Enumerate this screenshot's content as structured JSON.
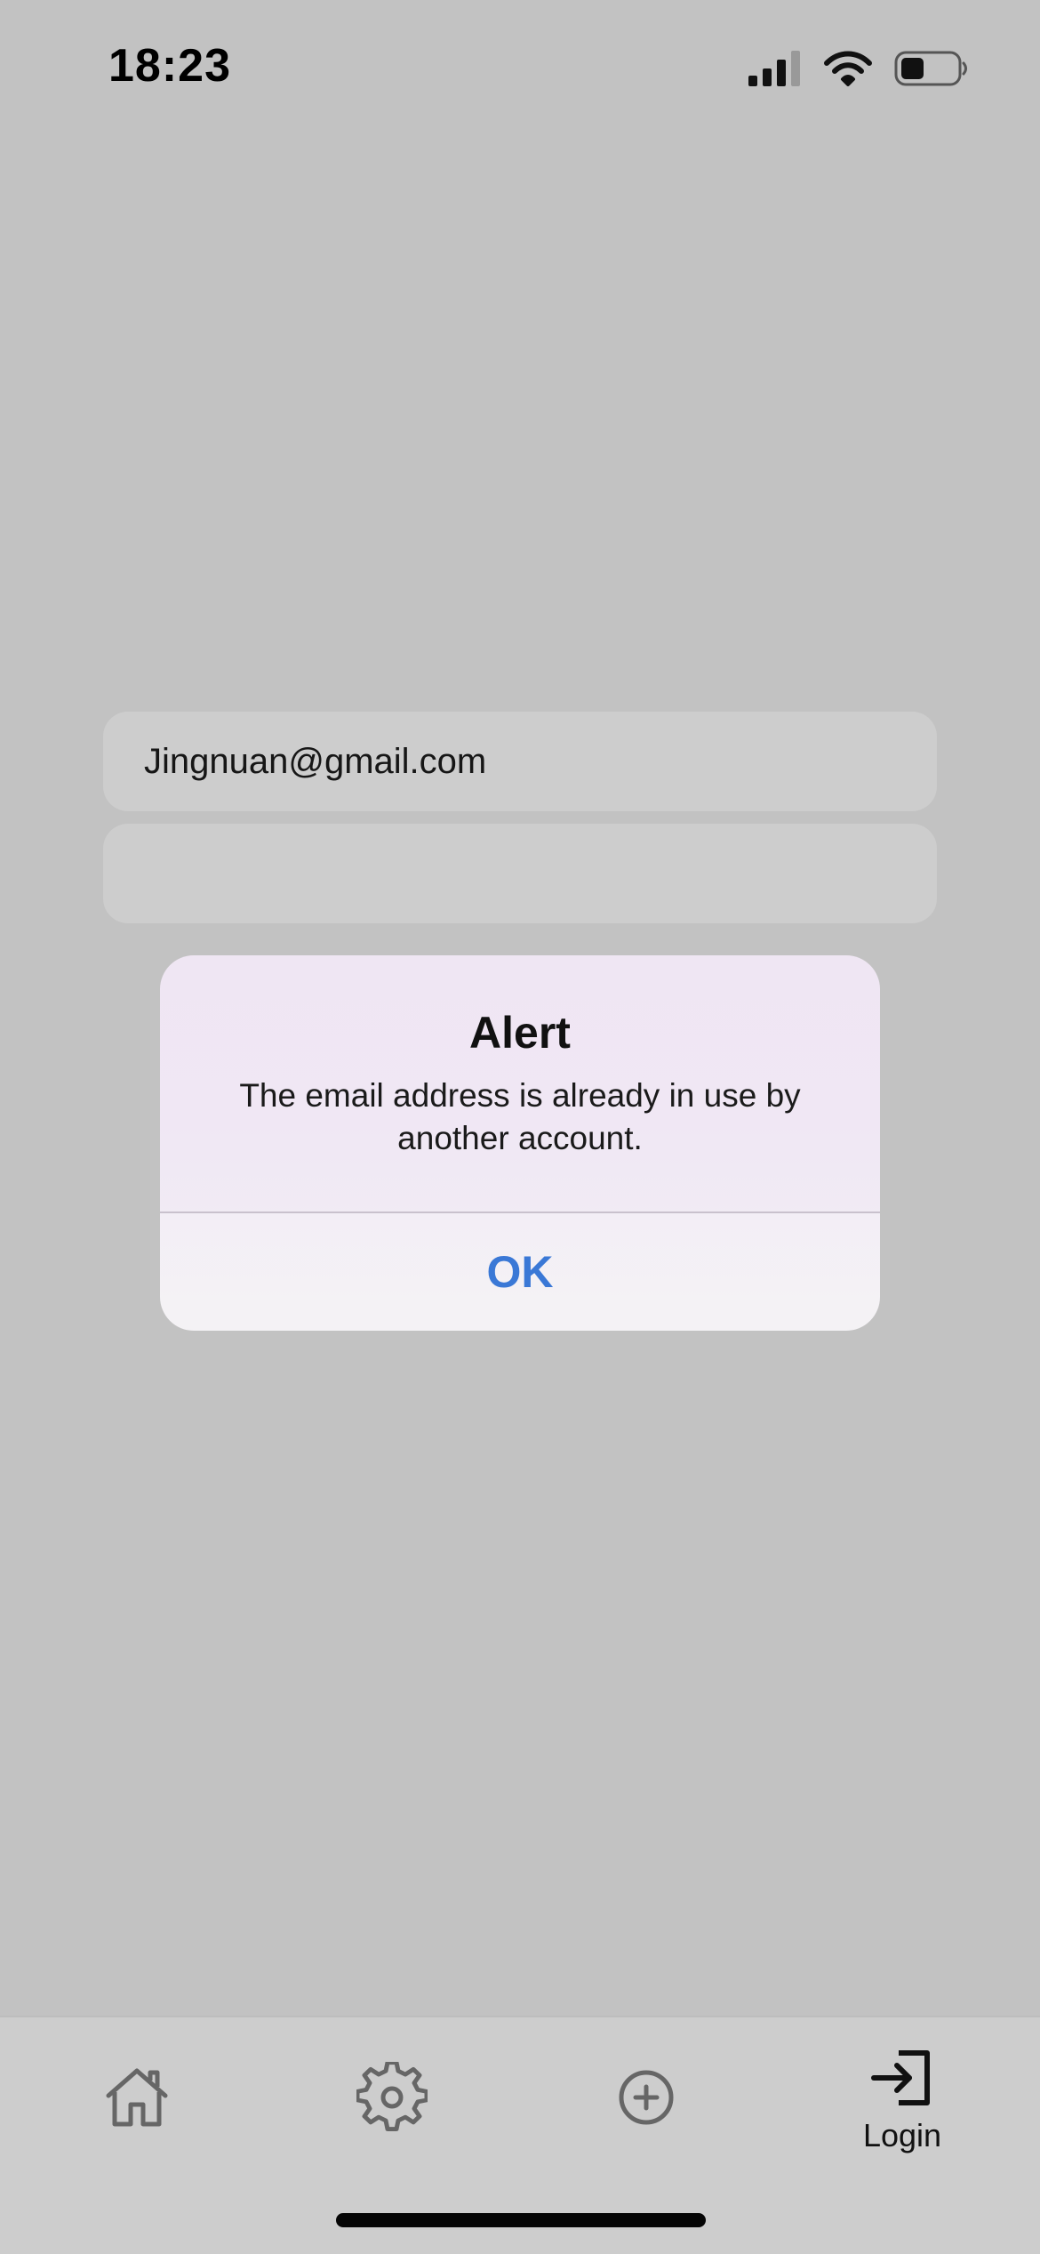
{
  "status_bar": {
    "time": "18:23",
    "signal_icon": "cellular-signal-icon",
    "wifi_icon": "wifi-icon",
    "battery_icon": "battery-icon"
  },
  "form": {
    "email_value": "Jingnuan@gmail.com",
    "password_value": ""
  },
  "alert": {
    "title": "Alert",
    "message": "The email address is already in use by another account.",
    "ok_label": "OK"
  },
  "tab_bar": {
    "items": [
      {
        "icon": "house-icon",
        "label": ""
      },
      {
        "icon": "gear-icon",
        "label": ""
      },
      {
        "icon": "plus-circle-icon",
        "label": ""
      },
      {
        "icon": "login-arrow-icon",
        "label": "Login"
      }
    ]
  },
  "colors": {
    "background": "#c2c2c2",
    "field": "#cdcdcd",
    "alert_tint": "#efe6f3",
    "alert_button_text": "#3a78d6",
    "tab_bar": "#cdcdcd",
    "tab_icon": "#666666"
  }
}
